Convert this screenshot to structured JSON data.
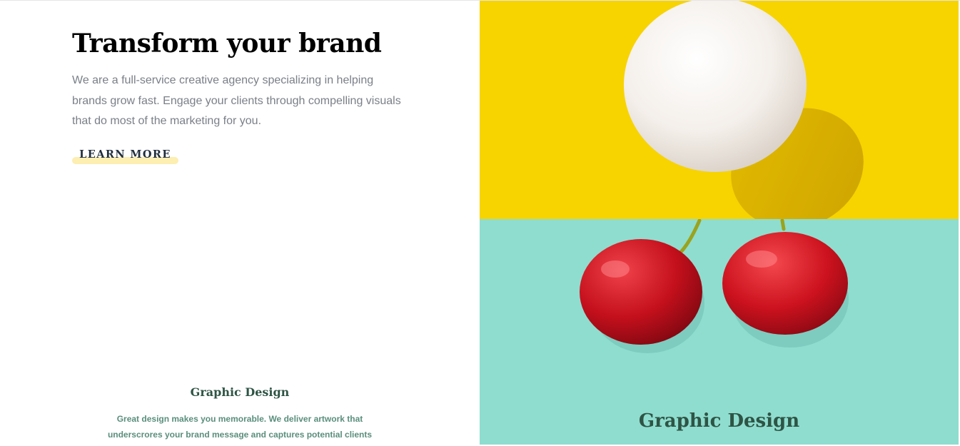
{
  "hero": {
    "title": "Transform your brand",
    "description": "We are a full-service creative agency specializing in helping brands grow fast. Engage your clients through compelling visuals that do most of the marketing for you.",
    "cta_label": "LEARN MORE"
  },
  "service": {
    "title": "Graphic Design",
    "description": "Great design makes you memorable. We deliver artwork that underscrores your brand message and captures potential clients"
  },
  "gallery": {
    "cherry_caption": "Graphic Design"
  },
  "colors": {
    "egg_background": "#f7d300",
    "cherry_background": "#8fddcf",
    "heading_green": "#2e5445",
    "body_green": "#5a8e7c",
    "cta_highlight": "#fdeeb1"
  }
}
